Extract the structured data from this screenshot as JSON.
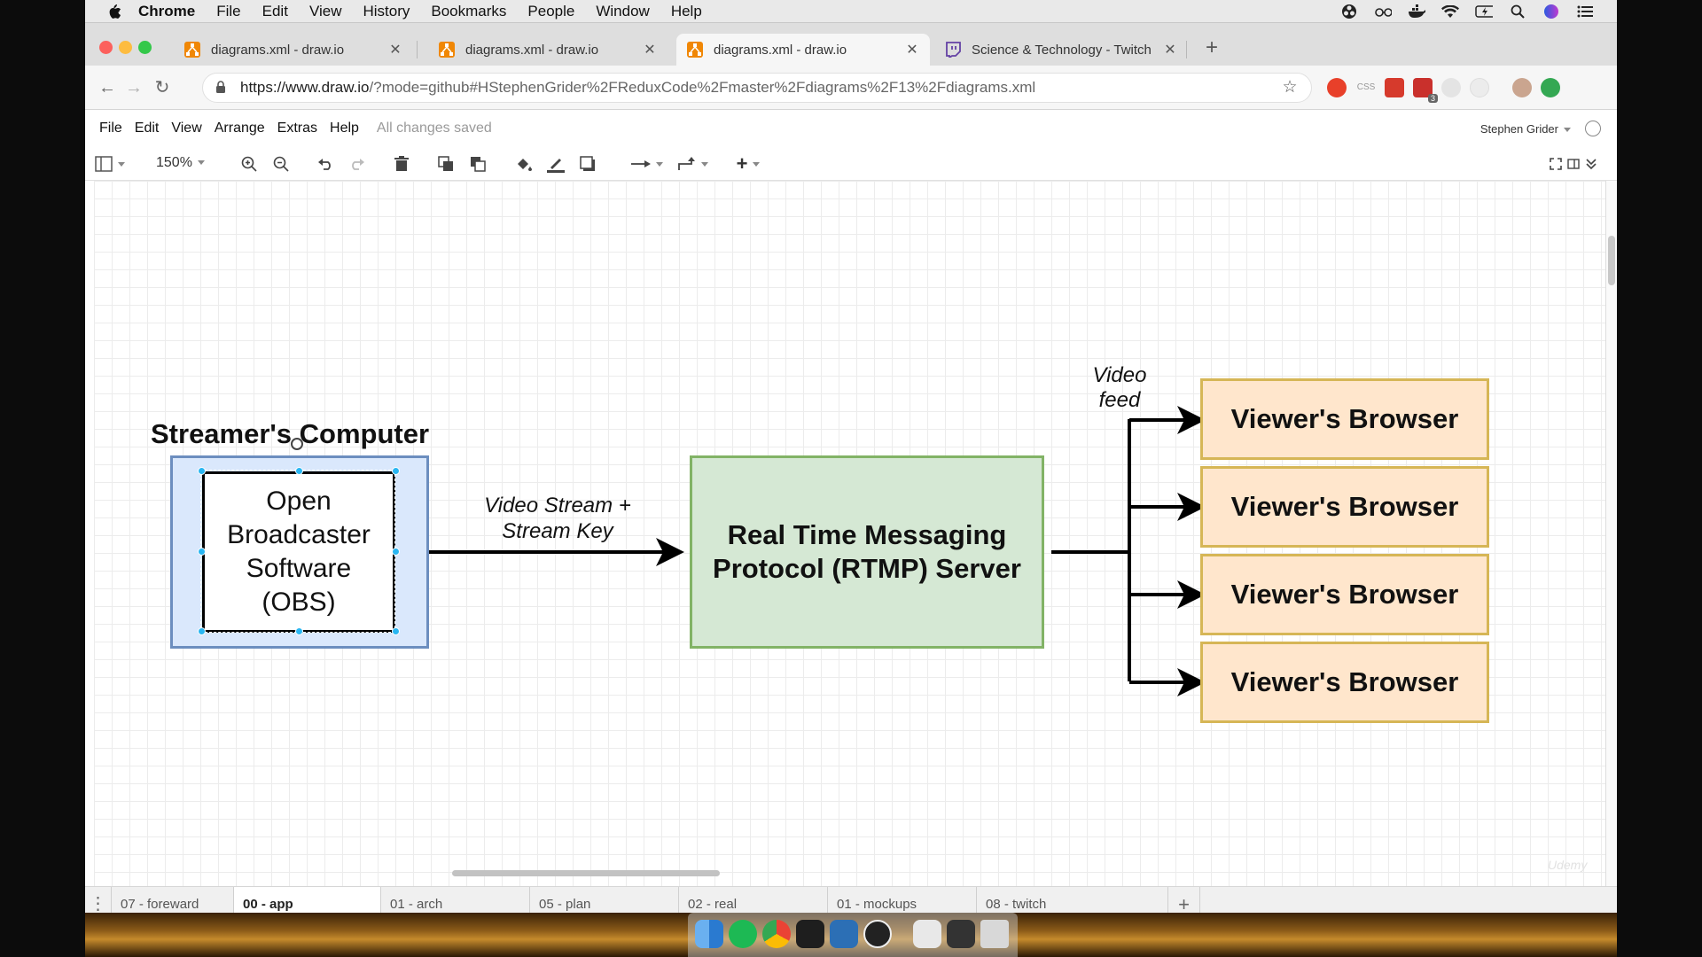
{
  "mac_menu": {
    "items": [
      "Chrome",
      "File",
      "Edit",
      "View",
      "History",
      "Bookmarks",
      "People",
      "Window",
      "Help"
    ]
  },
  "browser": {
    "tabs": [
      {
        "title": "diagrams.xml - draw.io",
        "icon": "drawio-icon",
        "active": false
      },
      {
        "title": "diagrams.xml - draw.io",
        "icon": "drawio-icon",
        "active": false
      },
      {
        "title": "diagrams.xml - draw.io",
        "icon": "drawio-icon",
        "active": true
      },
      {
        "title": "Science & Technology - Twitch",
        "icon": "twitch-icon",
        "active": false
      }
    ],
    "url_host": "https://www.draw.io",
    "url_rest": "/?mode=github#HStephenGrider%2FReduxCode%2Fmaster%2Fdiagrams%2F13%2Fdiagrams.xml",
    "extension_badge": "3",
    "extension_label": "CSS"
  },
  "drawio": {
    "menu": [
      "File",
      "Edit",
      "View",
      "Arrange",
      "Extras",
      "Help"
    ],
    "save_status": "All changes saved",
    "user": "Stephen Grider",
    "zoom": "150%",
    "colors": {
      "selected_fill": "#dae8fc",
      "selected_stroke": "#6c8ebf",
      "server_fill": "#d5e8d4",
      "server_stroke": "#82b366",
      "viewer_fill": "#ffe6cc",
      "viewer_stroke": "#d6b656",
      "selection_handle": "#29b6f2"
    }
  },
  "diagram": {
    "streamer_title": "Streamer's Computer",
    "obs_label": [
      "Open",
      "Broadcaster",
      "Software",
      "(OBS)"
    ],
    "stream_edge_label": [
      "Video Stream +",
      "Stream Key"
    ],
    "server_label": [
      "Real Time Messaging",
      "Protocol (RTMP) Server"
    ],
    "feed_label": [
      "Video",
      "feed"
    ],
    "viewers": [
      "Viewer's Browser",
      "Viewer's Browser",
      "Viewer's Browser",
      "Viewer's Browser"
    ]
  },
  "pages": [
    {
      "name": "07 - foreward",
      "active": false
    },
    {
      "name": "00 - app",
      "active": true
    },
    {
      "name": "01 - arch",
      "active": false
    },
    {
      "name": "05 - plan",
      "active": false
    },
    {
      "name": "02 - real",
      "active": false
    },
    {
      "name": "01 - mockups",
      "active": false
    },
    {
      "name": "08 - twitch",
      "active": false
    }
  ],
  "watermark": "Udemy"
}
